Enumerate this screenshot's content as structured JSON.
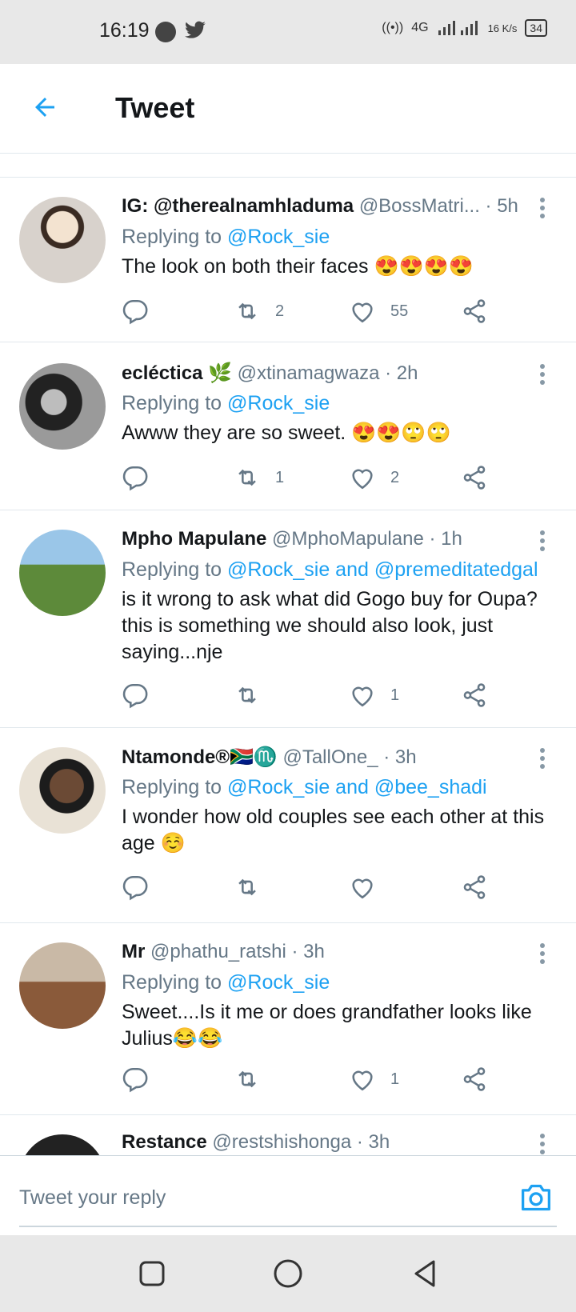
{
  "status": {
    "time": "16:19",
    "network": "4G",
    "speed": "16 K/s",
    "battery": "34"
  },
  "header": {
    "title": "Tweet"
  },
  "tweets": [
    {
      "name": "IG: @therealnamhladuma",
      "handle": "@BossMatri...",
      "time": "· 5h",
      "replying_prefix": "Replying to ",
      "replying_to": "@Rock_sie",
      "text": "The look on both their faces 😍😍😍😍",
      "retweets": "2",
      "likes": "55"
    },
    {
      "name": "ecléctica 🌿",
      "handle": "@xtinamagwaza",
      "time": "· 2h",
      "replying_prefix": "Replying to ",
      "replying_to": "@Rock_sie",
      "text": "Awww they are so sweet. 😍😍🙄🙄",
      "retweets": "1",
      "likes": "2"
    },
    {
      "name": "Mpho Mapulane",
      "handle": "@MphoMapulane",
      "time": "· 1h",
      "replying_prefix": "Replying to ",
      "replying_to": "@Rock_sie and @premeditatedgal",
      "text": "is it wrong to ask what did Gogo buy for Oupa? this is something we should also look, just saying...nje",
      "retweets": "",
      "likes": "1"
    },
    {
      "name": "Ntamonde®🇿🇦♏",
      "handle": "@TallOne_",
      "time": "· 3h",
      "replying_prefix": "Replying to ",
      "replying_to": "@Rock_sie and @bee_shadi",
      "text": "I wonder how old couples see each other at this age ☺️",
      "retweets": "",
      "likes": ""
    },
    {
      "name": "Mr",
      "handle": "@phathu_ratshi",
      "time": "· 3h",
      "replying_prefix": "Replying to ",
      "replying_to": "@Rock_sie",
      "text": "Sweet....Is it me or does grandfather looks like Julius😂😂",
      "retweets": "",
      "likes": "1"
    },
    {
      "name": "Restance",
      "handle": "@restshishonga",
      "time": "· 3h"
    }
  ],
  "composer": {
    "placeholder": "Tweet your reply"
  },
  "colors": {
    "accent": "#1da1f2",
    "secondary_text": "#657786",
    "divider": "#e1e8ed"
  }
}
